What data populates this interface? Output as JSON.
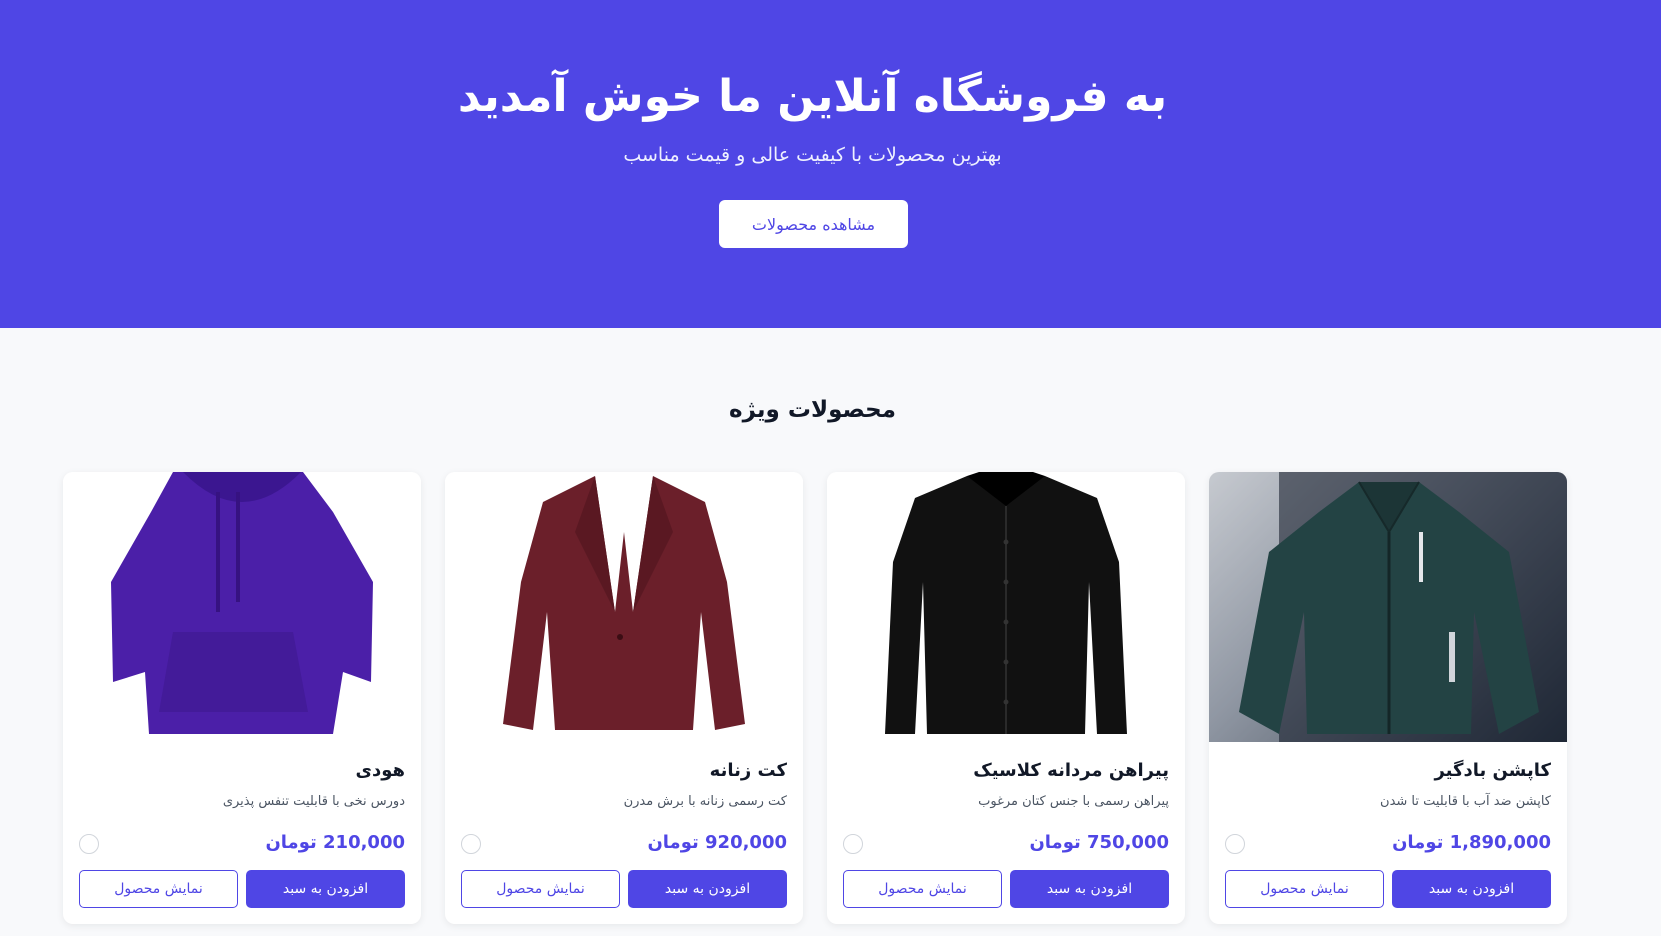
{
  "hero": {
    "title": "به فروشگاه آنلاین ما خوش آمدید",
    "subtitle": "بهترین محصولات با کیفیت عالی و قیمت مناسب",
    "cta_label": "مشاهده محصولات",
    "background_color": "#4f46e5"
  },
  "featured": {
    "title": "محصولات ویژه"
  },
  "products": [
    {
      "name": "کاپشن بادگیر",
      "description": "کاپشن ضد آب با قابلیت تا شدن",
      "price": "1,890,000 تومان",
      "image_icon": "jacket-image",
      "add_label": "افزودن به سبد",
      "view_label": "نمایش محصول"
    },
    {
      "name": "پیراهن مردانه کلاسیک",
      "description": "پیراهن رسمی با جنس کتان مرغوب",
      "price": "750,000 تومان",
      "image_icon": "shirt-image",
      "add_label": "افزودن به سبد",
      "view_label": "نمایش محصول"
    },
    {
      "name": "کت زنانه",
      "description": "کت رسمی زنانه با برش مدرن",
      "price": "920,000 تومان",
      "image_icon": "blazer-image",
      "add_label": "افزودن به سبد",
      "view_label": "نمایش محصول"
    },
    {
      "name": "هودی",
      "description": "دورس نخی با قابلیت تنفس پذیری",
      "price": "210,000 تومان",
      "image_icon": "hoodie-image",
      "add_label": "افزودن به سبد",
      "view_label": "نمایش محصول"
    }
  ]
}
